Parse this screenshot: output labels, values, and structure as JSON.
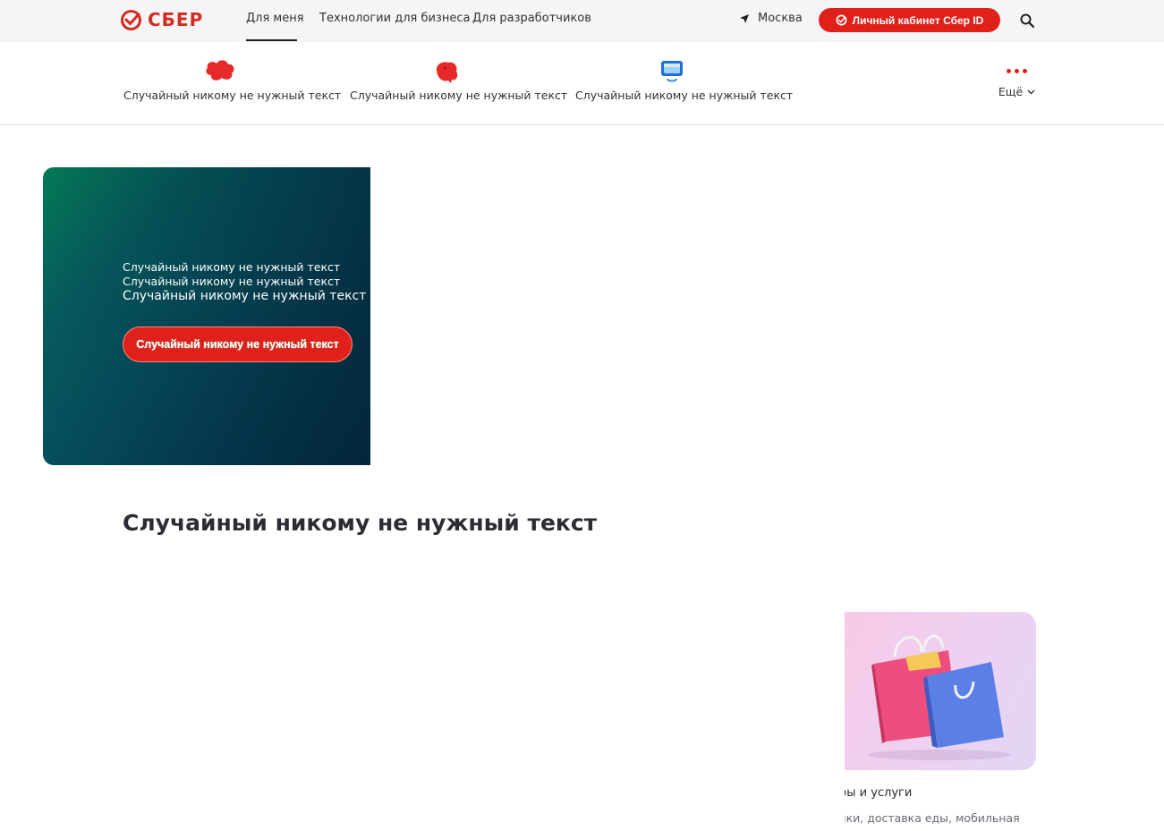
{
  "header": {
    "logo_text": "СБЕР",
    "nav": [
      {
        "label": "Для меня",
        "active": true
      },
      {
        "label": "Технологии для бизнеса",
        "active": false
      },
      {
        "label": "Для разработчиков",
        "active": false
      }
    ],
    "city": "Москва",
    "cabinet_button": "Личный кабинет Сбер ID",
    "accent_color": "#e0201a"
  },
  "services": {
    "items": [
      {
        "label": "Случайный никому не нужный текст",
        "icon": "red-blob-icon"
      },
      {
        "label": "Случайный никому не нужный текст",
        "icon": "red-piggy-icon"
      },
      {
        "label": "Случайный никому не нужный текст",
        "icon": "monitor-icon"
      }
    ],
    "more_label": "Ещё"
  },
  "banner": {
    "line1": "Случайный никому не нужный текст",
    "line2": "Случайный никому не нужный текст",
    "line3": "Случайный никому не нужный текст",
    "button": "Случайный никому не нужный текст"
  },
  "section": {
    "title": "Случайный никому не нужный текст"
  },
  "card": {
    "title": "ары и услуги",
    "description": "упки, доставка еды, мобильная"
  }
}
